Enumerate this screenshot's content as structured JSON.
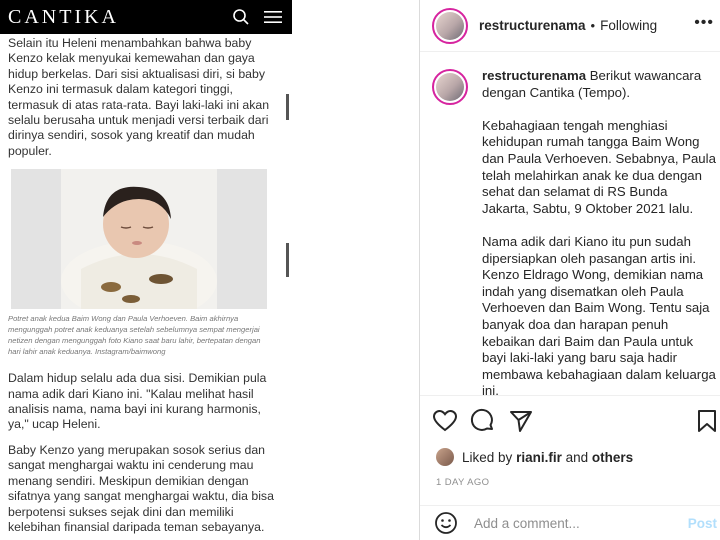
{
  "article": {
    "brand": "CANTIKA",
    "para1": "Selain itu Heleni menambahkan bahwa baby Kenzo kelak menyukai kemewahan dan gaya hidup berkelas. Dari sisi aktualisasi diri, si baby Kenzo ini termasuk dalam kategori tinggi, termasuk di atas rata-rata. Bayi laki-laki ini akan selalu berusaha untuk menjadi versi terbaik dari dirinya sendiri, sosok yang kreatif dan mudah populer.",
    "caption": "Potret anak kedua Baim Wong dan Paula Verhoeven. Baim akhirnya mengunggah potret anak keduanya setelah sebelumnya sempat mengerjai netizen dengan mengunggah foto Kiano saat baru lahir, bertepatan dengan hari lahir anak keduanya. Instagram/baimwong",
    "para2": "Dalam hidup selalu ada dua sisi. Demikian pula nama adik dari Kiano ini. \"Kalau melihat hasil analisis nama, nama bayi ini kurang harmonis, ya,\" ucap Heleni.",
    "para3": "Baby Kenzo yang merupakan sosok serius dan sangat menghargai waktu ini cenderung mau menang sendiri. Meskipun demikian dengan sifatnya yang sangat menghargai waktu, dia bisa berpotensi sukses sejak dini dan memiliki kelebihan finansial daripada teman sebayanya."
  },
  "instagram": {
    "username": "restructurenama",
    "separator": "•",
    "follow_status": "Following",
    "more": "•••",
    "caption_lines": [
      "Berikut wawancara dengan Cantika (Tempo).",
      "Kebahagiaan tengah menghiasi kehidupan rumah tangga Baim Wong dan Paula Verhoeven. Sebabnya, Paula telah melahirkan anak ke dua dengan sehat dan selamat di RS Bunda Jakarta, Sabtu, 9 Oktober 2021 lalu.",
      "Nama adik dari Kiano itu pun sudah dipersiapkan oleh pasangan artis ini. Kenzo Eldrago Wong, demikian nama indah yang disematkan oleh Paula Verhoeven dan Baim Wong. Tentu saja banyak doa dan harapan penuh kebaikan dari Baim dan Paula untuk bayi laki-laki yang baru saja hadir membawa kebahagiaan dalam keluarga ini."
    ],
    "liked_prefix": "Liked by ",
    "liked_user": "riani.fir",
    "liked_and": " and ",
    "liked_others": "others",
    "timestamp": "1 DAY AGO",
    "comment_placeholder": "Add a comment...",
    "post_label": "Post",
    "icons": [
      "search-icon",
      "menu-icon",
      "heart-icon",
      "comment-icon",
      "share-icon",
      "bookmark-icon",
      "emoji-icon"
    ]
  }
}
